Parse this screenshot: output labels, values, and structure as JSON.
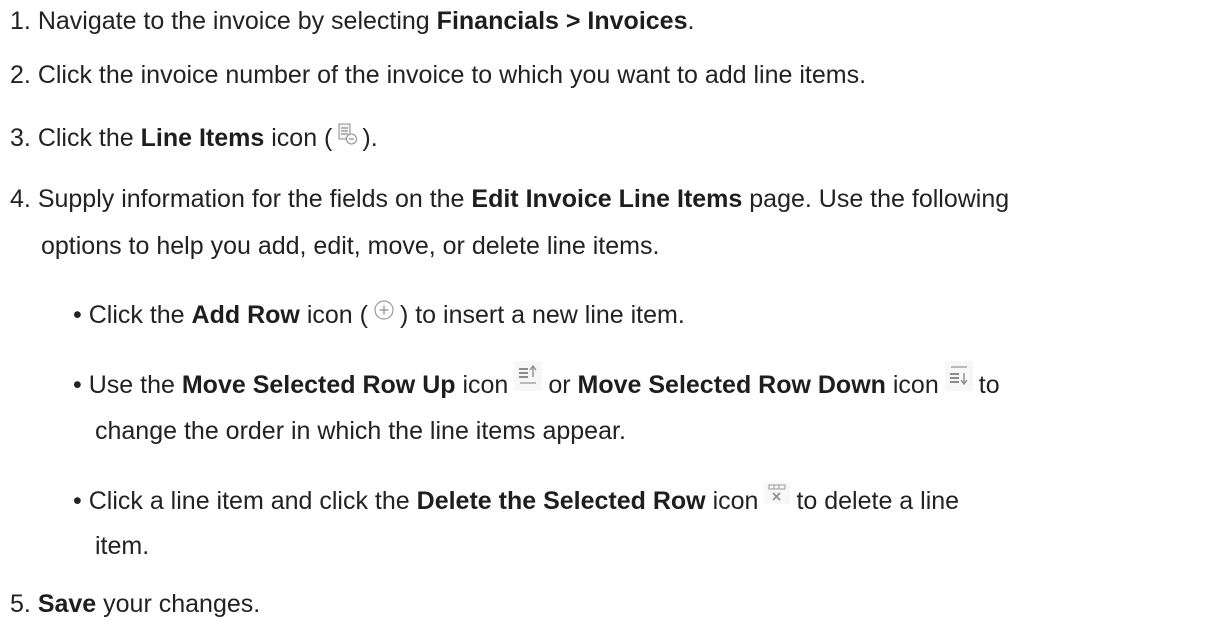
{
  "steps": {
    "s1": {
      "num": "1.",
      "pre": "Navigate to the invoice by selecting",
      "bold": "Financials > Invoices",
      "post": "."
    },
    "s2": {
      "num": "2.",
      "text": "Click the invoice number of the invoice to which you want to add line items."
    },
    "s3": {
      "num": "3.",
      "pre": "Click the",
      "bold": "Line Items",
      "mid": "icon (",
      "post": ")."
    },
    "s4": {
      "num": "4.",
      "pre": "Supply information for the fields on the",
      "bold": "Edit Invoice Line Items",
      "post": "page. Use the following",
      "line2": "options to help you add, edit, move, or delete line items."
    },
    "b1": {
      "bullet": "•",
      "pre": "Click the",
      "bold": "Add Row",
      "mid": "icon (",
      "post": ") to insert a new line item."
    },
    "b2": {
      "bullet": "•",
      "pre": "Use the",
      "bold1": "Move Selected Row Up",
      "mid1": "icon",
      "mid2": "or",
      "bold2": "Move Selected Row Down",
      "mid3": "icon",
      "post": "to",
      "line2": "change the order in which the line items appear."
    },
    "b3": {
      "bullet": "•",
      "pre": "Click a line item and click the",
      "bold": "Delete the Selected Row",
      "mid": "icon",
      "post": "to delete a line",
      "line2": "item."
    },
    "s5": {
      "num": "5.",
      "bold": "Save",
      "post": "your changes."
    }
  },
  "icons": {
    "line_items": "line-items-icon",
    "add_row": "add-row-icon",
    "move_up": "move-row-up-icon",
    "move_down": "move-row-down-icon",
    "delete_row": "delete-row-icon"
  },
  "colors": {
    "text": "#222222",
    "icon_gray": "#9a9a9a"
  }
}
